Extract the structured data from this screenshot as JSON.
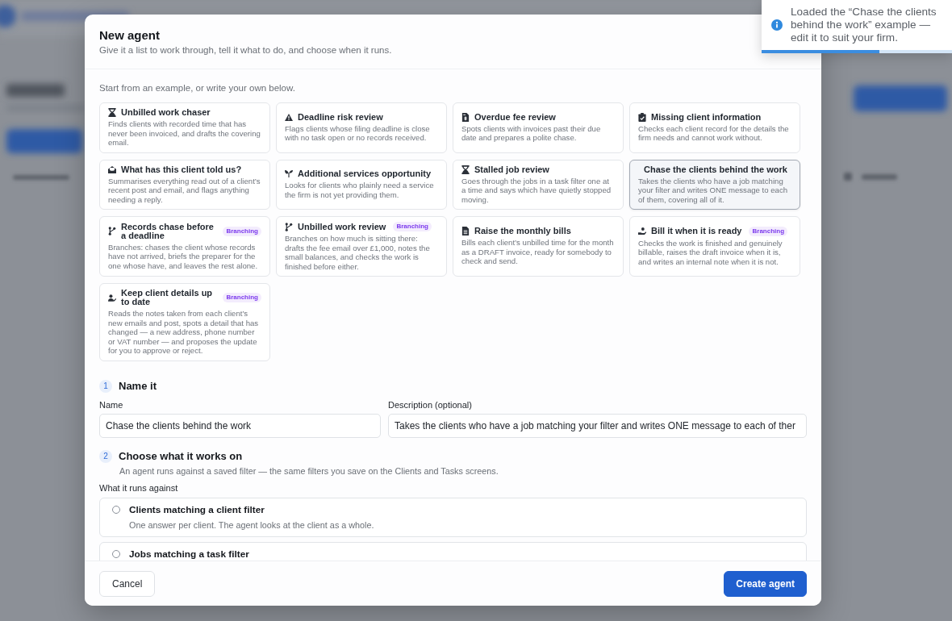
{
  "toast": {
    "message": "Loaded the “Chase the clients behind the work” example — edit it to suit your firm.",
    "level": 0.62
  },
  "dialog": {
    "title": "New agent",
    "subtitle": "Give it a list to work through, tell it what to do, and choose when it runs."
  },
  "examples": {
    "intro": "Start from an example, or write your own below.",
    "cards": [
      {
        "title": "Unbilled work chaser",
        "description": "Finds clients with recorded time that has never been invoiced, and drafts the covering email.",
        "selected": false
      },
      {
        "title": "Deadline risk review",
        "description": "Flags clients whose filing deadline is close with no task open or no records received.",
        "selected": false
      },
      {
        "title": "Overdue fee review",
        "description": "Spots clients with invoices past their due date and prepares a polite chase.",
        "selected": false
      },
      {
        "title": "Missing client information",
        "description": "Checks each client record for the details the firm needs and cannot work without.",
        "selected": false
      },
      {
        "title": "What has this client told us?",
        "description": "Summarises everything read out of a client’s recent post and email, and flags anything needing a reply.",
        "selected": false
      },
      {
        "title": "Additional services opportunity",
        "description": "Looks for clients who plainly need a service the firm is not yet providing them.",
        "selected": false
      },
      {
        "title": "Stalled job review",
        "description": "Goes through the jobs in a task filter one at a time and says which have quietly stopped moving.",
        "selected": false
      },
      {
        "title": "Chase the clients behind the work",
        "description": "Takes the clients who have a job matching your filter and writes ONE message to each of them, covering all of it.",
        "selected": true
      },
      {
        "title": "Records chase before a deadline",
        "badge": "Branching",
        "description": "Branches: chases the client whose records have not arrived, briefs the preparer for the one whose have, and leaves the rest alone.",
        "selected": false
      },
      {
        "title": "Unbilled work review",
        "badge": "Branching",
        "description": "Branches on how much is sitting there: drafts the fee email over £1,000, notes the small balances, and checks the work is finished before either.",
        "selected": false
      },
      {
        "title": "Raise the monthly bills",
        "description": "Bills each client’s unbilled time for the month as a DRAFT invoice, ready for somebody to check and send.",
        "selected": false
      },
      {
        "title": "Bill it when it is ready",
        "badge": "Branching",
        "description": "Checks the work is finished and genuinely billable, raises the draft invoice when it is, and writes an internal note when it is not.",
        "selected": false
      },
      {
        "title": "Keep client details up to date",
        "badge": "Branching",
        "description": "Reads the notes taken from each client’s new emails and post, spots a detail that has changed — a new address, phone number or VAT number — and proposes the update for you to approve or reject.",
        "selected": false
      }
    ]
  },
  "name_section": {
    "number": "1",
    "title": "Name it",
    "fields": [
      {
        "label": "Name",
        "value": "Chase the clients behind the work"
      },
      {
        "label": "Description (optional)",
        "value": "Takes the clients who have a job matching your filter and writes ONE message to each of ther"
      }
    ]
  },
  "target_section": {
    "number": "2",
    "title": "Choose what it works on",
    "hint": "An agent runs against a saved filter — the same filters you save on the Clients and Tasks screens.",
    "label": "What it runs against",
    "options": [
      {
        "title": "Clients matching a client filter",
        "description": "One answer per client. The agent looks at the client as a whole.",
        "selected": false
      },
      {
        "title": "Jobs matching a task filter",
        "selected": false
      }
    ]
  },
  "footer": {
    "buttons": [
      {
        "label": "Cancel",
        "kind": "secondary"
      },
      {
        "label": "Create agent",
        "kind": "primary"
      }
    ]
  }
}
